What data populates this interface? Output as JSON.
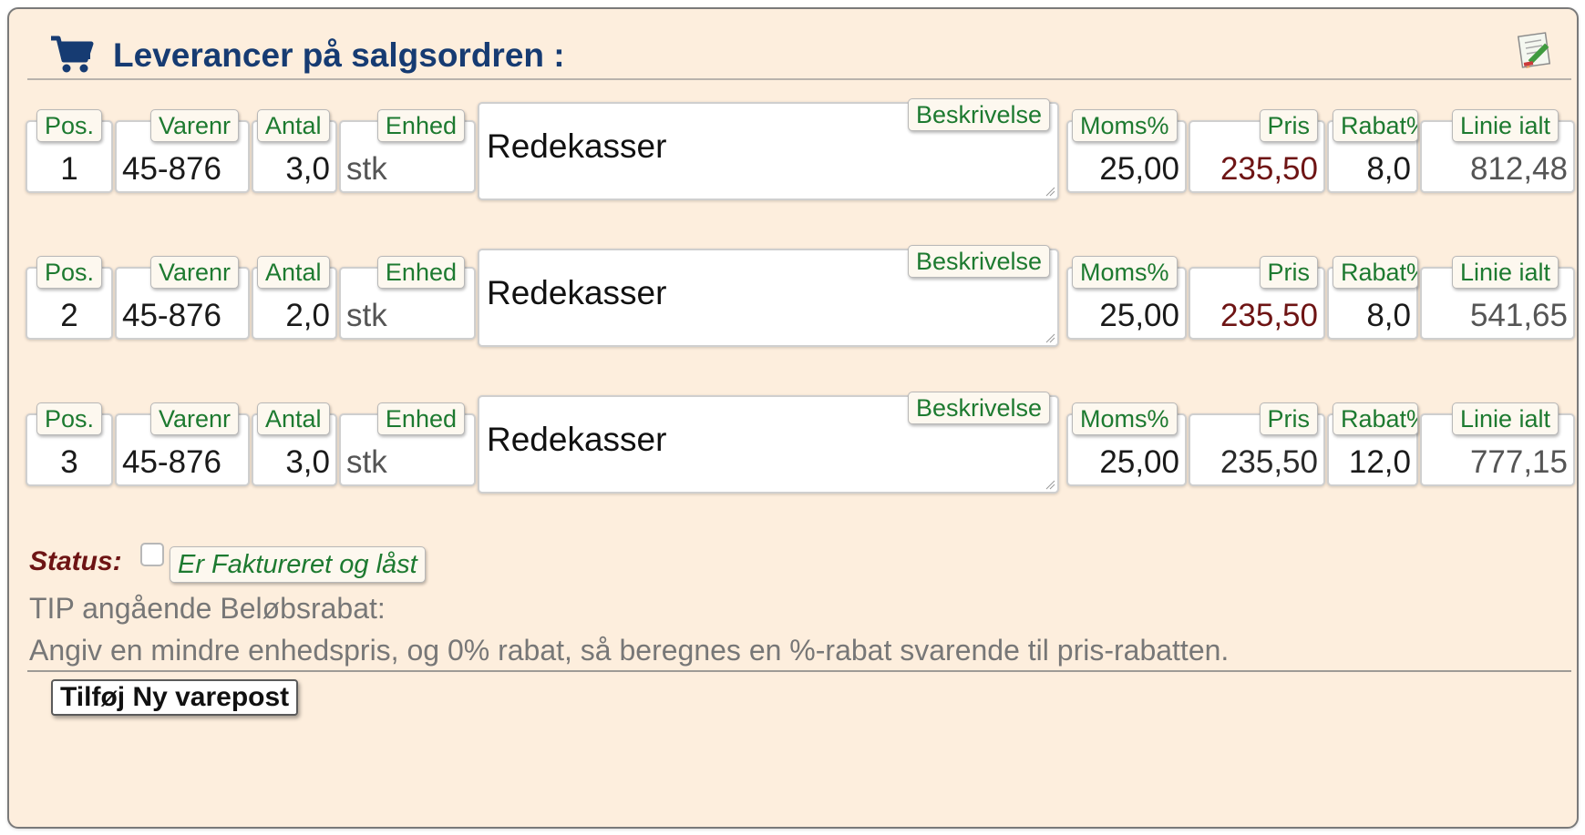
{
  "header": {
    "title": "Leverancer på salgsordren :",
    "cart_icon": "shopping-cart-icon",
    "edit_icon": "edit-notes-icon"
  },
  "labels": {
    "pos": "Pos.",
    "varenr": "Varenr",
    "antal": "Antal",
    "enhed": "Enhed",
    "beskrivelse": "Beskrivelse",
    "moms": "Moms%",
    "pris": "Pris",
    "rabat": "Rabat%",
    "linie": "Linie ialt"
  },
  "rows": [
    {
      "pos": "1",
      "varenr": "45-876",
      "antal": "3,0",
      "enhed": "stk",
      "beskrivelse": "Redekasser",
      "moms": "25,00",
      "pris": "235,50",
      "rabat": "8,0",
      "linie": "812,48"
    },
    {
      "pos": "2",
      "varenr": "45-876",
      "antal": "2,0",
      "enhed": "stk",
      "beskrivelse": "Redekasser",
      "moms": "25,00",
      "pris": "235,50",
      "rabat": "8,0",
      "linie": "541,65"
    },
    {
      "pos": "3",
      "varenr": "45-876",
      "antal": "3,0",
      "enhed": "stk",
      "beskrivelse": "Redekasser",
      "moms": "25,00",
      "pris": "235,50",
      "rabat": "12,0",
      "linie": "777,15"
    }
  ],
  "status": {
    "label": "Status:",
    "checkbox_checked": false,
    "checkbox_label": "Er Faktureret og låst"
  },
  "tip": {
    "title": "TIP angående Beløbsrabat:",
    "text": "Angiv en mindre enhedspris, og 0% rabat, så beregnes en %-rabat svarende til pris-rabatten."
  },
  "actions": {
    "add_line": "Tilføj Ny varepost"
  },
  "colors": {
    "panel_bg": "#fdeedd",
    "title": "#163b72",
    "label_green": "#1d7a30",
    "status_red": "#6e1414",
    "price_red": "#6e1414"
  }
}
